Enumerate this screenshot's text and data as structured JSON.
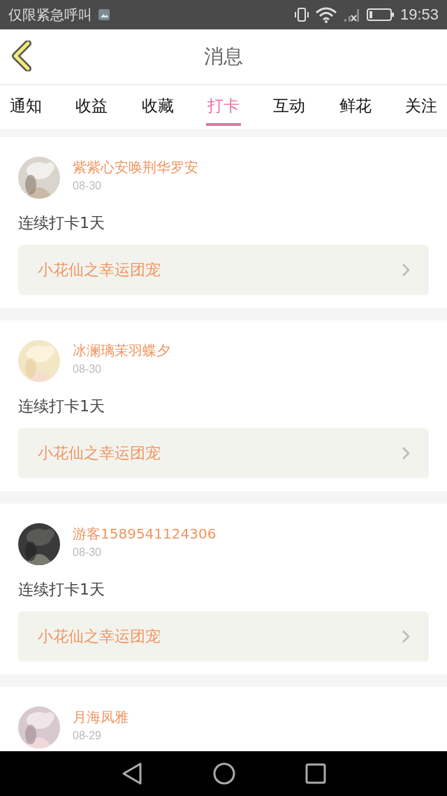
{
  "status_bar": {
    "carrier": "仅限紧急呼叫",
    "time": "19:53"
  },
  "header": {
    "title": "消息"
  },
  "tabs": [
    {
      "label": "通知",
      "selected": false
    },
    {
      "label": "收益",
      "selected": false
    },
    {
      "label": "收藏",
      "selected": false
    },
    {
      "label": "打卡",
      "selected": true
    },
    {
      "label": "互动",
      "selected": false
    },
    {
      "label": "鲜花",
      "selected": false
    },
    {
      "label": "关注",
      "selected": false
    }
  ],
  "messages": [
    {
      "name": "紫紫心安唤荆华罗安",
      "date": "08-30",
      "text": "连续打卡1天",
      "link": "小花仙之幸运团宠"
    },
    {
      "name": "冰澜璃茉羽蝶夕",
      "date": "08-30",
      "text": "连续打卡1天",
      "link": "小花仙之幸运团宠"
    },
    {
      "name": "游客1589541124306",
      "date": "08-30",
      "text": "连续打卡1天",
      "link": "小花仙之幸运团宠"
    },
    {
      "name": "月海凤雅",
      "date": "08-29"
    }
  ]
}
